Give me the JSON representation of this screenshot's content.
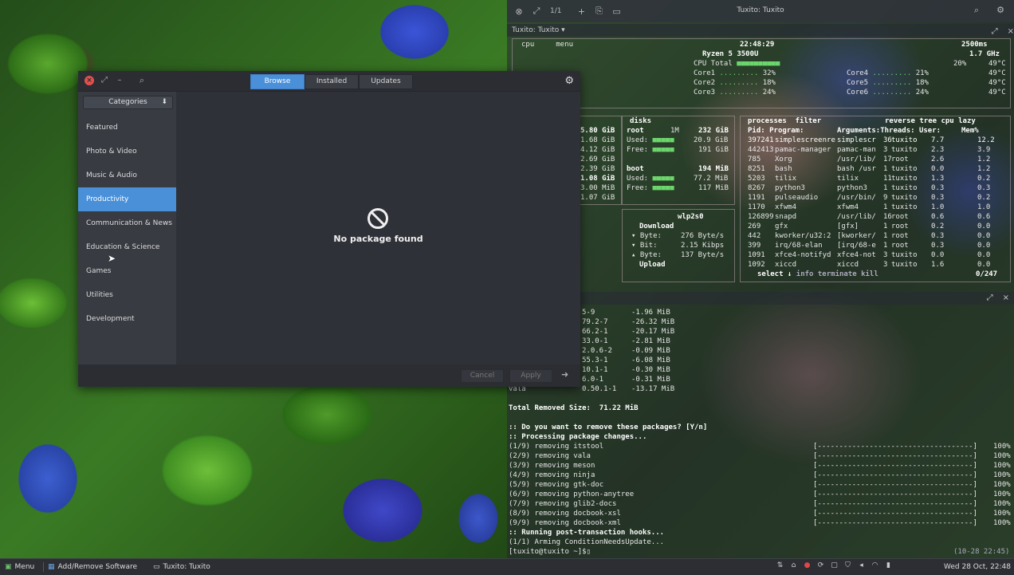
{
  "terminal": {
    "title": "Tuxito: Tuxito",
    "pages": "1/1",
    "tab_label": "Tuxito: Tuxito",
    "btop": {
      "cpu_tab": "cpu",
      "menu_tab": "menu",
      "time": "22:48:29",
      "refresh": "2500ms",
      "cpu_name": "Ryzen 5 3500U",
      "freq": "1.7 GHz",
      "cpu_total_label": "CPU Total",
      "cores": [
        {
          "name": "Core1",
          "pct": "32%",
          "name2": "Core4",
          "pct2": "21%"
        },
        {
          "name": "Core2",
          "pct": "18%",
          "name2": "Core5",
          "pct2": "18%"
        },
        {
          "name": "Core3",
          "pct": "24%",
          "name2": "Core6",
          "pct2": "24%"
        }
      ],
      "total_pct": "20%",
      "temps": [
        "49°C",
        "49°C",
        "49°C",
        "49°C"
      ],
      "mem_sizes": [
        "5.80 GiB",
        "1.68 GiB",
        "4.12 GiB",
        "2.69 GiB",
        "2.39 GiB",
        "1.08 GiB",
        "3.00 MiB",
        "1.07 GiB"
      ],
      "disks_label": "disks",
      "disk_root": {
        "name": "root",
        "io": "1M",
        "size": "232 GiB",
        "used_label": "Used:",
        "used": "20.9 GiB",
        "free_label": "Free:",
        "free": "191 GiB"
      },
      "disk_boot": {
        "name": "boot",
        "size": "194 MiB",
        "used_label": "Used:",
        "used": "77.2 MiB",
        "free_label": "Free:",
        "free": "117 MiB"
      },
      "net": {
        "iface": "wlp2s0",
        "download_label": "Download",
        "byte_label": "Byte:",
        "byte": "276 Byte/s",
        "bit_label": "Bit:",
        "bit": "2.15 Kibps",
        "byte2_label": "Byte:",
        "byte2": "137 Byte/s",
        "upload_label": "Upload"
      },
      "proc": {
        "title": "processes",
        "filter": "filter",
        "reverse": "reverse",
        "tree": "tree",
        "sort": "cpu lazy",
        "headers": [
          "Pid:",
          "Program:",
          "Arguments:",
          "Threads:",
          "User:",
          "Mem%"
        ],
        "rows": [
          [
            "397241",
            "simplescreenre",
            "simplescr",
            "36",
            "tuxito",
            "7.7",
            "12.2"
          ],
          [
            "442413",
            "pamac-manager",
            "pamac-man",
            "3",
            "tuxito",
            "2.3",
            "3.9"
          ],
          [
            "785",
            "Xorg",
            "/usr/lib/",
            "17",
            "root",
            "2.6",
            "1.2"
          ],
          [
            "8251",
            "bash",
            "bash /usr",
            "1",
            "tuxito",
            "0.0",
            "1.2"
          ],
          [
            "5203",
            "tilix",
            "tilix",
            "11",
            "tuxito",
            "1.3",
            "0.2"
          ],
          [
            "8267",
            "python3",
            "python3",
            "1",
            "tuxito",
            "0.3",
            "0.3"
          ],
          [
            "1191",
            "pulseaudio",
            "/usr/bin/",
            "9",
            "tuxito",
            "0.3",
            "0.2"
          ],
          [
            "1170",
            "xfwm4",
            "xfwm4",
            "1",
            "tuxito",
            "1.0",
            "1.0"
          ],
          [
            "126899",
            "snapd",
            "/usr/lib/",
            "16",
            "root",
            "0.6",
            "0.6"
          ],
          [
            "269",
            "gfx",
            "[gfx]",
            "1",
            "root",
            "0.2",
            "0.0"
          ],
          [
            "442",
            "kworker/u32:2",
            "[kworker/",
            "1",
            "root",
            "0.3",
            "0.0"
          ],
          [
            "399",
            "irq/68-elan",
            "[irq/68-e",
            "1",
            "root",
            "0.3",
            "0.0"
          ],
          [
            "1091",
            "xfce4-notifyd",
            "xfce4-not",
            "3",
            "tuxito",
            "0.0",
            "0.0"
          ],
          [
            "1092",
            "xiccd",
            "xiccd",
            "3",
            "tuxito",
            "1.6",
            "0.0"
          ]
        ],
        "select_label": "select",
        "info_label": "info",
        "terminate_label": "terminate",
        "kill_label": "kill",
        "count": "0/247"
      }
    },
    "removal": {
      "packages": [
        {
          "ver": "5-9",
          "size": "-1.96 MiB"
        },
        {
          "ver": "79.2-7",
          "size": "-26.32 MiB"
        },
        {
          "ver": "66.2-1",
          "size": "-20.17 MiB"
        },
        {
          "ver": "33.0-1",
          "size": "-2.81 MiB"
        },
        {
          "ver": "2.0.6-2",
          "size": "-0.09 MiB"
        },
        {
          "ver": "55.3-1",
          "size": "-6.08 MiB"
        },
        {
          "ver": "10.1-1",
          "size": "-0.30 MiB"
        },
        {
          "ver": "6.0-1",
          "size": "-0.31 MiB"
        },
        {
          "ver": "0.50.1-1",
          "size": "-13.17 MiB",
          "name": "vala"
        }
      ],
      "total_label": "Total Removed Size:",
      "total": "71.22 MiB",
      "prompt": ":: Do you want to remove these packages? [Y/n]",
      "processing": ":: Processing package changes...",
      "steps": [
        {
          "n": "(1/9)",
          "text": "removing itstool"
        },
        {
          "n": "(2/9)",
          "text": "removing vala"
        },
        {
          "n": "(3/9)",
          "text": "removing meson"
        },
        {
          "n": "(4/9)",
          "text": "removing ninja"
        },
        {
          "n": "(5/9)",
          "text": "removing gtk-doc"
        },
        {
          "n": "(6/9)",
          "text": "removing python-anytree"
        },
        {
          "n": "(7/9)",
          "text": "removing glib2-docs"
        },
        {
          "n": "(8/9)",
          "text": "removing docbook-xsl"
        },
        {
          "n": "(9/9)",
          "text": "removing docbook-xml"
        }
      ],
      "hooks": ":: Running post-transaction hooks...",
      "hook1": "(1/1) Arming ConditionNeedsUpdate...",
      "progress_pct": "100%",
      "prompt_user": "[tuxito@tuxito ~]$",
      "timestamp": "(10-28 22:45)"
    }
  },
  "pm": {
    "tabs": [
      "Browse",
      "Installed",
      "Updates"
    ],
    "active_tab": 0,
    "categories_label": "Categories",
    "categories": [
      "Featured",
      "Photo & Video",
      "Music & Audio",
      "Productivity",
      "Communication & News",
      "Education & Science",
      "Games",
      "Utilities",
      "Development"
    ],
    "active_category": 3,
    "empty_message": "No package found",
    "cancel_label": "Cancel",
    "apply_label": "Apply"
  },
  "taskbar": {
    "menu_label": "Menu",
    "task1": "Add/Remove Software",
    "task2": "Tuxito: Tuxito",
    "clock": "Wed 28 Oct, 22:48"
  },
  "colors": {
    "accent": "#4a90d9",
    "close": "#e2504c",
    "window_bg": "#2f3138",
    "sidebar_bg": "#383b42"
  }
}
